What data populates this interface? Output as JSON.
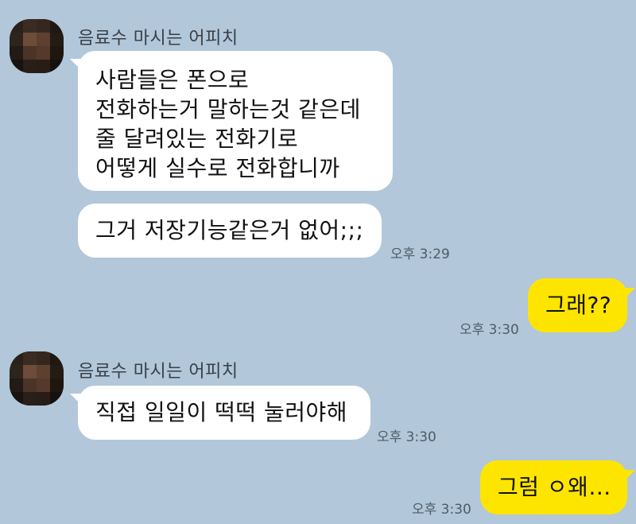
{
  "colors": {
    "background": "#b2c7da",
    "incoming_bubble": "#ffffff",
    "outgoing_bubble": "#fee500"
  },
  "chat": {
    "group1": {
      "sender": "음료수 마시는 어피치",
      "avatar_icon": "profile-avatar-pixelated",
      "msg1_lines": [
        "사람들은 폰으로",
        "전화하는거 말하는것 같은데",
        "줄 달려있는 전화기로",
        "어떻게 실수로 전화합니까"
      ],
      "msg2": "그거 저장기능같은거 없어;;;",
      "time": "오후 3:29"
    },
    "out1": {
      "text": "그래??",
      "time": "오후 3:30"
    },
    "group2": {
      "sender": "음료수 마시는 어피치",
      "avatar_icon": "profile-avatar-pixelated",
      "msg1": "직접 일일이 떡떡 눌러야해",
      "time": "오후 3:30"
    },
    "out2": {
      "text": "그럼 ㅇ왜...",
      "time": "오후 3:30"
    }
  }
}
